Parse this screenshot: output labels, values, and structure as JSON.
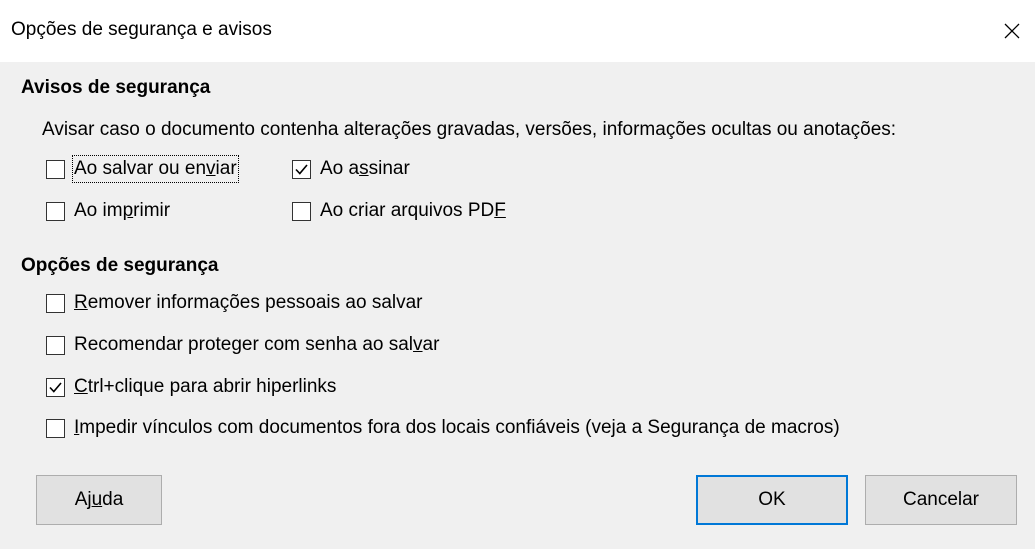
{
  "window": {
    "title": "Opções de segurança e avisos",
    "close_icon": "close-icon"
  },
  "warnings_section": {
    "heading": "Avisos de segurança",
    "description": "Avisar caso o documento contenha alterações gravadas, versões, informações ocultas ou anotações:",
    "options": [
      {
        "label_pre": "Ao salvar ou en",
        "label_ul": "v",
        "label_post": "iar",
        "checked": false
      },
      {
        "label_pre": "Ao a",
        "label_ul": "s",
        "label_post": "sinar",
        "checked": true
      },
      {
        "label_pre": "Ao im",
        "label_ul": "p",
        "label_post": "rimir",
        "checked": false
      },
      {
        "label_pre": "Ao criar arquivos PD",
        "label_ul": "F",
        "label_post": "",
        "checked": false
      }
    ]
  },
  "security_section": {
    "heading": "Opções de segurança",
    "options": [
      {
        "label_pre": "",
        "label_ul": "R",
        "label_post": "emover informações pessoais ao salvar",
        "checked": false
      },
      {
        "label_pre": "Recomendar proteger com senha ao sal",
        "label_ul": "v",
        "label_post": "ar",
        "checked": false
      },
      {
        "label_pre": "",
        "label_ul": "C",
        "label_post": "trl+clique para abrir hiperlinks",
        "checked": true
      },
      {
        "label_pre": "",
        "label_ul": "I",
        "label_post": "mpedir vínculos com documentos fora dos locais confiáveis (veja a Segurança de macros)",
        "checked": false
      }
    ]
  },
  "buttons": {
    "help": {
      "pre": "Aj",
      "ul": "u",
      "post": "da"
    },
    "ok": {
      "label": "OK"
    },
    "cancel": {
      "label": "Cancelar"
    }
  }
}
